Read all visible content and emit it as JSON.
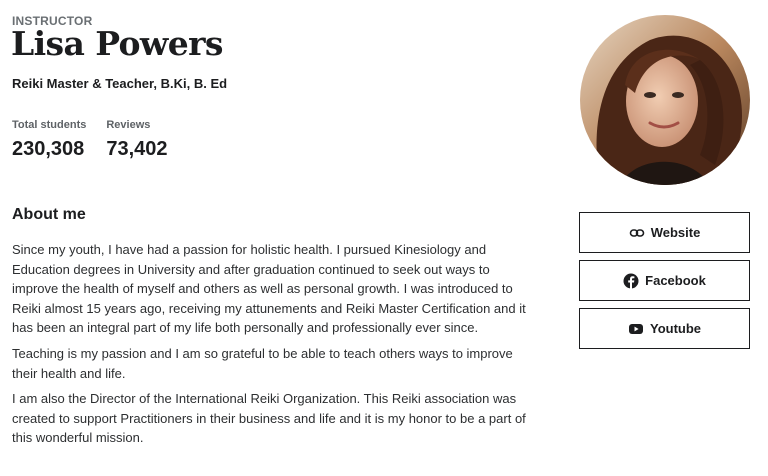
{
  "profile": {
    "eyebrow": "INSTRUCTOR",
    "name": "Lisa Powers",
    "headline": "Reiki Master & Teacher, B.Ki, B. Ed"
  },
  "stats": [
    {
      "label": "Total students",
      "value": "230,308"
    },
    {
      "label": "Reviews",
      "value": "73,402"
    }
  ],
  "about": {
    "title": "About me",
    "paragraphs": [
      "Since my youth, I have had a passion for holistic health. I pursued Kinesiology and Education degrees in University and after graduation continued to seek out ways to improve the health of myself and others as well as personal growth. I was introduced to Reiki almost 15 years ago, receiving my attunements and Reiki Master Certification and it has been an integral part of my life both personally and professionally ever since.",
      "Teaching is my passion and I am so grateful to be able to teach others ways to improve their health and life.",
      "I am also the Director of the International Reiki Organization. This Reiki association was created to support Practitioners in their business and life and it is my honor to be a part of this wonderful mission."
    ]
  },
  "links": [
    {
      "label": "Website",
      "icon": "link-icon"
    },
    {
      "label": "Facebook",
      "icon": "facebook-icon"
    },
    {
      "label": "Youtube",
      "icon": "youtube-icon"
    }
  ],
  "colors": {
    "text": "#1c1d1f",
    "muted": "#6a6f73",
    "border": "#1c1d1f"
  }
}
